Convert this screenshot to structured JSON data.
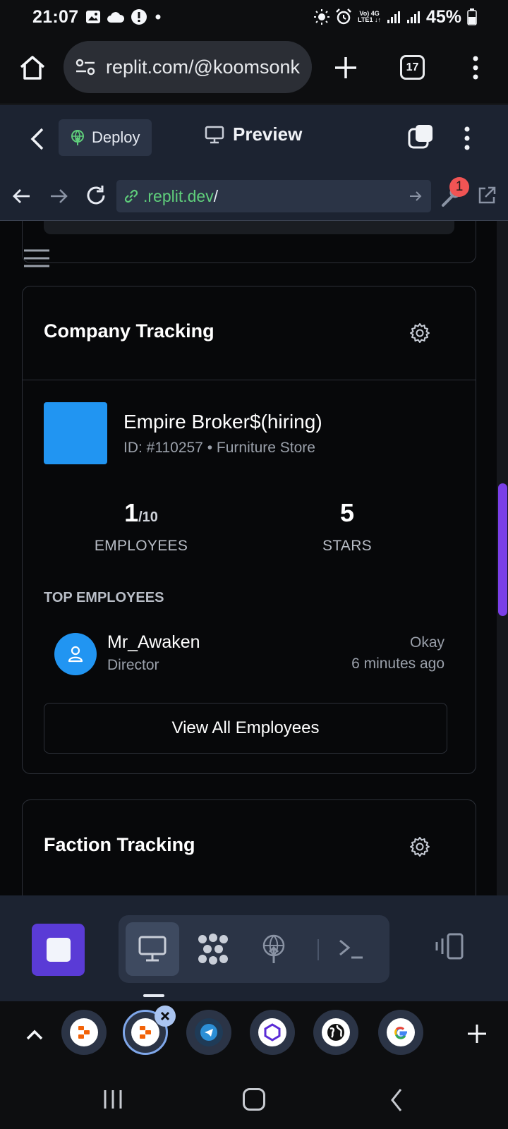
{
  "status_bar": {
    "time": "21:07",
    "network_top": "Vo) 4G",
    "network_bottom": "LTE1 ↓↑",
    "battery": "45%"
  },
  "browser": {
    "url": "replit.com/@koomsonk",
    "tab_count": "17"
  },
  "replit_header": {
    "deploy_label": "Deploy",
    "preview_label": "Preview"
  },
  "preview_nav": {
    "address": ".replit.dev",
    "address_suffix": "/",
    "devtools_badge": "1"
  },
  "company_card": {
    "title": "Company Tracking",
    "company_name": "Empire Broker$(hiring)",
    "company_meta": "ID: #110257 • Furniture Store",
    "logo_color": "#2195F2",
    "employees_value": "1",
    "employees_max": "/10",
    "employees_label": "EMPLOYEES",
    "stars_value": "5",
    "stars_label": "STARS",
    "section_label": "TOP EMPLOYEES",
    "employee": {
      "name": "Mr_Awaken",
      "role": "Director",
      "status": "Okay",
      "last_seen": "6 minutes ago"
    },
    "view_all_label": "View All Employees"
  },
  "faction_card": {
    "title": "Faction Tracking"
  },
  "colors": {
    "accent_purple": "#5A3BD6",
    "link_green": "#5FCE7B",
    "badge_red": "#F05454"
  }
}
